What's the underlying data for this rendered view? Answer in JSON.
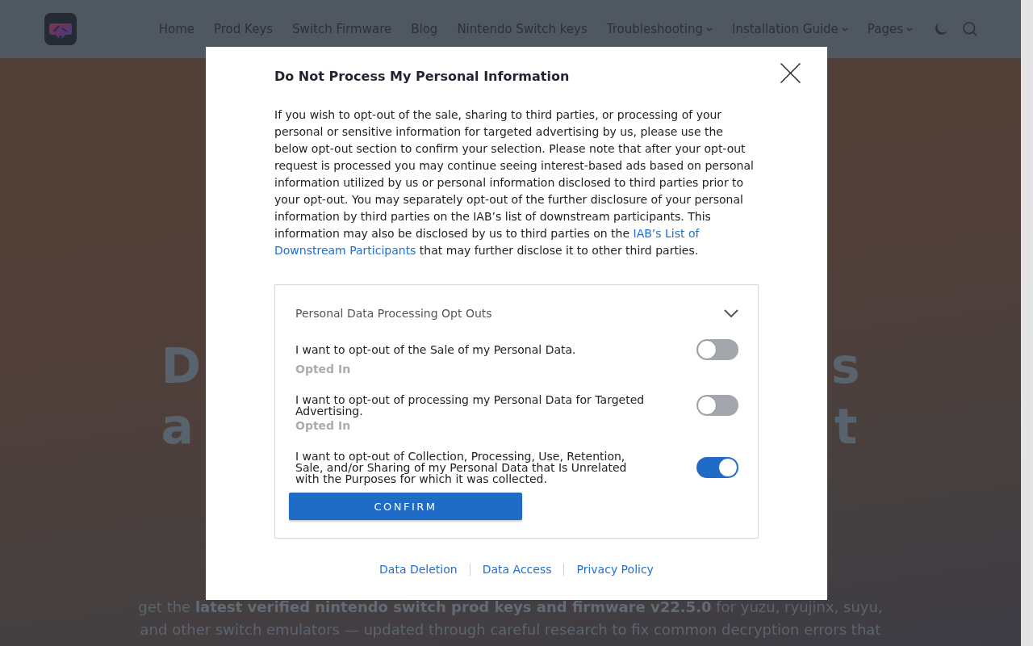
{
  "header": {
    "nav": [
      {
        "label": "Home",
        "has_menu": false
      },
      {
        "label": "Prod Keys",
        "has_menu": false
      },
      {
        "label": "Switch Firmware",
        "has_menu": false
      },
      {
        "label": "Blog",
        "has_menu": false
      },
      {
        "label": "Nintendo Switch keys",
        "has_menu": false
      },
      {
        "label": "Troubleshooting",
        "has_menu": true
      },
      {
        "label": "Installation Guide",
        "has_menu": true
      },
      {
        "label": "Pages",
        "has_menu": true
      }
    ]
  },
  "hero": {
    "title_lines": [
      {
        "left": "D",
        "right": "s"
      },
      {
        "left": "a",
        "right": "t"
      }
    ],
    "intro": "get the **latest verified nintendo switch prod keys and firmware v22.5.0** for yuzu, ryujinx, suyu, and other switch emulators — updated through careful research to fix common decryption errors that"
  },
  "dialog": {
    "title": "Do Not Process My Personal Information",
    "body": [
      {
        "kind": "text",
        "text": "If you wish to opt-out of the sale, sharing to third parties, or processing of your personal or sensitive information for targeted advertising by us, please use the below opt-out section to confirm your selection. Please note that after your opt-out request is processed you may continue seeing interest-based ads based on personal information utilized by us or personal information disclosed to third parties prior to your opt-out. You may separately opt-out of the further disclosure of your personal information by third parties on the IAB’s list of downstream participants. This information may also be disclosed by us to third parties on the "
      },
      {
        "kind": "link",
        "text": "IAB’s List of"
      },
      {
        "kind": "link",
        "text": "Downstream Participants"
      },
      {
        "kind": "text",
        "text": " that may further disclose it to other third parties."
      }
    ],
    "opt_outs": {
      "title": "Personal Data Processing Opt Outs",
      "items": [
        {
          "label": "I want to opt-out of the Sale of my Personal Data.",
          "on": false,
          "status": "Opted In"
        },
        {
          "label": "I want to opt-out of processing my Personal Data for Targeted Advertising.",
          "on": false,
          "status": "Opted In"
        },
        {
          "label": "I want to opt-out of Collection, Processing, Use, Retention, Sale, and/or Sharing of my Personal Data that Is Unrelated with the Purposes for which it was collected.",
          "on": true
        }
      ],
      "confirm": "CONFIRM"
    },
    "links": [
      "Data Deletion",
      "Data Access",
      "Privacy Policy"
    ]
  }
}
